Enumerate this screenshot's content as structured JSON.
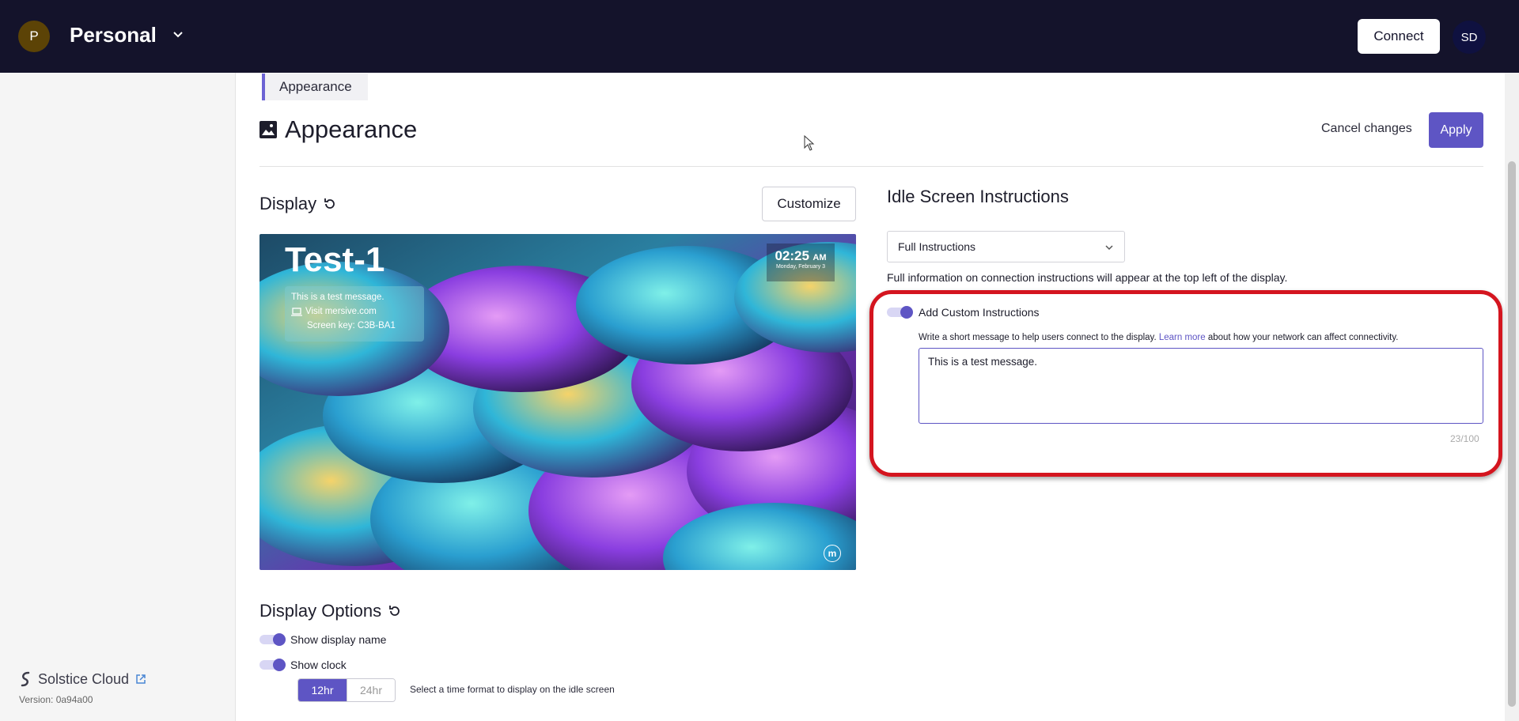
{
  "header": {
    "org_initial": "P",
    "org_name": "Personal",
    "connect_label": "Connect",
    "user_initials": "SD"
  },
  "sidebar": {
    "brand_name": "Solstice Cloud",
    "version": "Version: 0a94a00"
  },
  "breadcrumb": "Appearance",
  "page": {
    "title": "Appearance",
    "cancel_label": "Cancel changes",
    "apply_label": "Apply"
  },
  "display": {
    "title": "Display",
    "customize_label": "Customize",
    "preview": {
      "name": "Test-1",
      "message": "This is a test message.",
      "visit": "Visit mersive.com",
      "screen_key": "Screen key: C3B-BA1",
      "time": "02:25",
      "ampm": "AM",
      "date": "Monday, February 3",
      "logo_letter": "m"
    }
  },
  "display_options": {
    "title": "Display Options",
    "show_display_name_label": "Show display name",
    "show_display_name": true,
    "show_clock_label": "Show clock",
    "show_clock": true,
    "time_formats": [
      "12hr",
      "24hr"
    ],
    "selected_time_format": "12hr",
    "time_format_hint": "Select a time format to display on the idle screen"
  },
  "idle_screen": {
    "title": "Idle Screen Instructions",
    "selected_option": "Full Instructions",
    "description": "Full information on connection instructions will appear at the top left of the display.",
    "custom_label": "Add Custom Instructions",
    "custom_enabled": true,
    "custom_desc_before": "Write a short message to help users connect to the display. ",
    "custom_desc_link": "Learn more",
    "custom_desc_after": " about how your network can affect connectivity.",
    "custom_text": "This is a test message.",
    "char_count": "23/100"
  },
  "colors": {
    "accent": "#5e55c4",
    "header_bg": "#14132b",
    "highlight": "#d4151f"
  }
}
